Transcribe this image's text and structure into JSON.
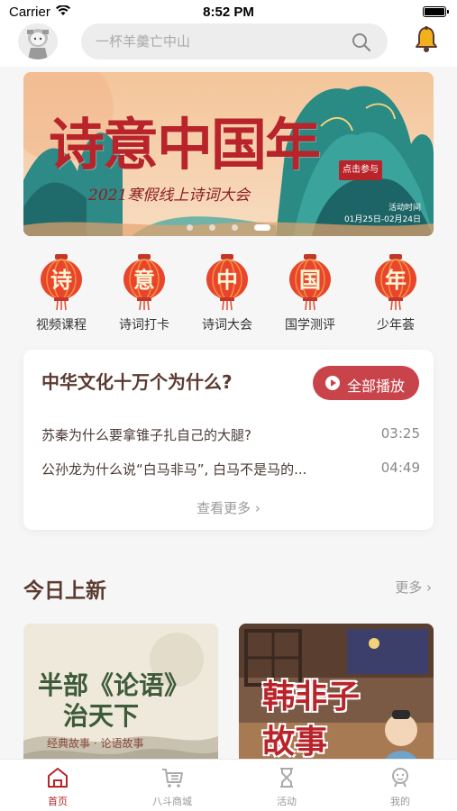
{
  "status_bar": {
    "carrier": "Carrier",
    "time": "8:52 PM"
  },
  "search": {
    "placeholder": "一杯羊羹亡中山"
  },
  "banner": {
    "title": "诗意中国年",
    "subtitle": "2021寒假线上诗词大会",
    "seal": "点击参与",
    "date_label": "活动时间",
    "date_range": "01月25日-02月24日",
    "slides": 5,
    "active_slide": 4
  },
  "categories": [
    {
      "glyph": "诗",
      "label": "视频课程"
    },
    {
      "glyph": "意",
      "label": "诗词打卡"
    },
    {
      "glyph": "中",
      "label": "诗词大会"
    },
    {
      "glyph": "国",
      "label": "国学测评"
    },
    {
      "glyph": "年",
      "label": "少年荟"
    }
  ],
  "culture": {
    "title": "中华文化十万个为什么?",
    "play_all": "全部播放",
    "episodes": [
      {
        "title": "苏秦为什么要拿锥子扎自己的大腿?",
        "time": "03:25"
      },
      {
        "title": "公孙龙为什么说“白马非马”, 白马不是马的...",
        "time": "04:49"
      }
    ],
    "view_more": "查看更多 ›"
  },
  "new_section": {
    "title": "今日上新",
    "more": "更多 ›"
  },
  "new_items": [
    {
      "title_line1": "半部《论语》",
      "title_line2": "治天下",
      "subtitle": "经典故事 · 论语故事"
    },
    {
      "title_line1": "韩非子",
      "title_line2": "故事"
    }
  ],
  "tabs": [
    {
      "label": "首页",
      "icon": "home-icon",
      "active": true
    },
    {
      "label": "八斗商城",
      "icon": "cart-icon",
      "active": false
    },
    {
      "label": "活动",
      "icon": "hourglass-icon",
      "active": false
    },
    {
      "label": "我的",
      "icon": "profile-icon",
      "active": false
    }
  ],
  "colors": {
    "accent": "#b8242a",
    "button": "#c9444a",
    "heading": "#5b3a30",
    "lantern": "#e8452c"
  }
}
